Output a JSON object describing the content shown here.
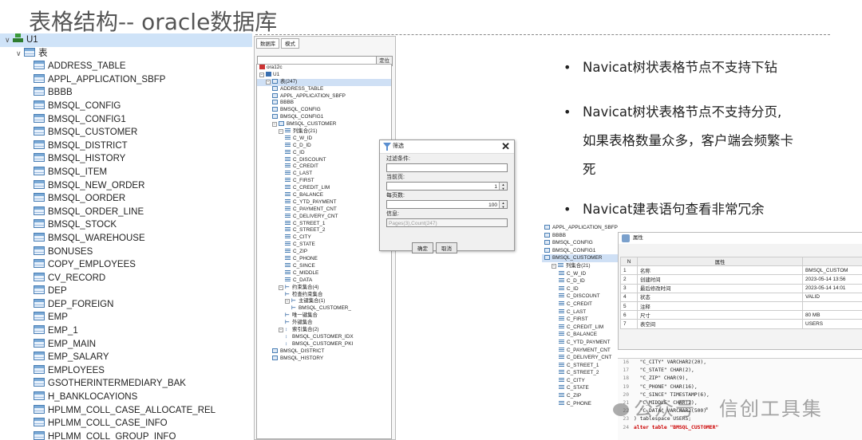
{
  "slide": {
    "title": "表格结构-- oracle数据库"
  },
  "nav_tree": {
    "root": "U1",
    "group": "表",
    "tables": [
      "ADDRESS_TABLE",
      "APPL_APPLICATION_SBFP",
      "BBBB",
      "BMSQL_CONFIG",
      "BMSQL_CONFIG1",
      "BMSQL_CUSTOMER",
      "BMSQL_DISTRICT",
      "BMSQL_HISTORY",
      "BMSQL_ITEM",
      "BMSQL_NEW_ORDER",
      "BMSQL_OORDER",
      "BMSQL_ORDER_LINE",
      "BMSQL_STOCK",
      "BMSQL_WAREHOUSE",
      "BONUSES",
      "COPY_EMPLOYEES",
      "CV_RECORD",
      "DEP",
      "DEP_FOREIGN",
      "EMP",
      "EMP_1",
      "EMP_MAIN",
      "EMP_SALARY",
      "EMPLOYEES",
      "GSOTHERINTERMEDIARY_BAK",
      "H_BANKLOCAYIONS",
      "HPLMM_COLL_CASE_ALLOCATE_REL",
      "HPLMM_COLL_CASE_INFO",
      "HPLMM_COLL_GROUP_INFO"
    ]
  },
  "client_tree": {
    "tabs": [
      "数据库",
      "模式"
    ],
    "locate_button": "定位",
    "rows": [
      {
        "indent": 0,
        "kind": "db",
        "text": "ora12c"
      },
      {
        "indent": 0,
        "kind": "user",
        "text": "U1",
        "pm": "⊟"
      },
      {
        "indent": 1,
        "kind": "table",
        "text": "表(247)",
        "pm": "⊟",
        "selected": true
      },
      {
        "indent": 2,
        "kind": "table",
        "text": "ADDRESS_TABLE"
      },
      {
        "indent": 2,
        "kind": "table",
        "text": "APPL_APPLICATION_SBFP"
      },
      {
        "indent": 2,
        "kind": "table",
        "text": "BBBB"
      },
      {
        "indent": 2,
        "kind": "table",
        "text": "BMSQL_CONFIG"
      },
      {
        "indent": 2,
        "kind": "table",
        "text": "BMSQL_CONFIG1"
      },
      {
        "indent": 2,
        "kind": "table",
        "text": "BMSQL_CUSTOMER",
        "pm": "⊟"
      },
      {
        "indent": 3,
        "kind": "col",
        "text": "列集合(21)",
        "pm": "⊟"
      },
      {
        "indent": 4,
        "kind": "col",
        "text": "C_W_ID"
      },
      {
        "indent": 4,
        "kind": "col",
        "text": "C_D_ID"
      },
      {
        "indent": 4,
        "kind": "col",
        "text": "C_ID"
      },
      {
        "indent": 4,
        "kind": "col",
        "text": "C_DISCOUNT"
      },
      {
        "indent": 4,
        "kind": "col",
        "text": "C_CREDIT"
      },
      {
        "indent": 4,
        "kind": "col",
        "text": "C_LAST"
      },
      {
        "indent": 4,
        "kind": "col",
        "text": "C_FIRST"
      },
      {
        "indent": 4,
        "kind": "col",
        "text": "C_CREDIT_LIM"
      },
      {
        "indent": 4,
        "kind": "col",
        "text": "C_BALANCE"
      },
      {
        "indent": 4,
        "kind": "col",
        "text": "C_YTD_PAYMENT"
      },
      {
        "indent": 4,
        "kind": "col",
        "text": "C_PAYMENT_CNT"
      },
      {
        "indent": 4,
        "kind": "col",
        "text": "C_DELIVERY_CNT"
      },
      {
        "indent": 4,
        "kind": "col",
        "text": "C_STREET_1"
      },
      {
        "indent": 4,
        "kind": "col",
        "text": "C_STREET_2"
      },
      {
        "indent": 4,
        "kind": "col",
        "text": "C_CITY"
      },
      {
        "indent": 4,
        "kind": "col",
        "text": "C_STATE"
      },
      {
        "indent": 4,
        "kind": "col",
        "text": "C_ZIP"
      },
      {
        "indent": 4,
        "kind": "col",
        "text": "C_PHONE"
      },
      {
        "indent": 4,
        "kind": "col",
        "text": "C_SINCE"
      },
      {
        "indent": 4,
        "kind": "col",
        "text": "C_MIDDLE"
      },
      {
        "indent": 4,
        "kind": "col",
        "text": "C_DATA"
      },
      {
        "indent": 3,
        "kind": "key",
        "text": "约束集合(4)",
        "pm": "⊟"
      },
      {
        "indent": 4,
        "kind": "key",
        "text": "检查约束集合"
      },
      {
        "indent": 4,
        "kind": "key",
        "text": "主键集合(1)",
        "pm": "⊟"
      },
      {
        "indent": 5,
        "kind": "key",
        "text": "BMSQL_CUSTOMER_"
      },
      {
        "indent": 4,
        "kind": "key",
        "text": "唯一键集合"
      },
      {
        "indent": 4,
        "kind": "key",
        "text": "外键集合"
      },
      {
        "indent": 3,
        "kind": "idx",
        "text": "索引集合(2)",
        "pm": "⊟"
      },
      {
        "indent": 4,
        "kind": "idx",
        "text": "BMSQL_CUSTOMER_IDX"
      },
      {
        "indent": 4,
        "kind": "idx",
        "text": "BMSQL_CUSTOMER_PKI"
      },
      {
        "indent": 2,
        "kind": "table",
        "text": "BMSQL_DISTRICT"
      },
      {
        "indent": 2,
        "kind": "table",
        "text": "BMSQL_HISTORY"
      }
    ]
  },
  "filter_dialog": {
    "title": "筛选",
    "close": "✕",
    "condition_label": "过滤条件:",
    "condition_value": "",
    "current_page_label": "当前页:",
    "current_page_value": "1",
    "per_page_label": "每页数:",
    "per_page_value": "100",
    "info_label": "信息:",
    "info_value": "Pages(3),Count(247)",
    "ok_button": "确定",
    "cancel_button": "取消"
  },
  "bullets": {
    "item1": "Navicat树状表格节点不支持下钻",
    "item2_line1": "Navicat树状表格节点不支持分页,",
    "item2_line2": "如果表格数量众多，客户端会频繁卡",
    "item2_line3": "死",
    "item3": "Navicat建表语句查看非常冗余"
  },
  "shot2": {
    "tree_rows": [
      {
        "indent": 0,
        "kind": "table",
        "text": "APPL_APPLICATION_SBFP"
      },
      {
        "indent": 0,
        "kind": "table",
        "text": "BBBB"
      },
      {
        "indent": 0,
        "kind": "table",
        "text": "BMSQL_CONFIG"
      },
      {
        "indent": 0,
        "kind": "table",
        "text": "BMSQL_CONFIG1"
      },
      {
        "indent": 0,
        "kind": "table",
        "text": "BMSQL_CUSTOMER",
        "selected": true
      },
      {
        "indent": 1,
        "kind": "col",
        "text": "列集合(21)",
        "pm": "⊟"
      },
      {
        "indent": 2,
        "kind": "col",
        "text": "C_W_ID"
      },
      {
        "indent": 2,
        "kind": "col",
        "text": "C_D_ID"
      },
      {
        "indent": 2,
        "kind": "col",
        "text": "C_ID"
      },
      {
        "indent": 2,
        "kind": "col",
        "text": "C_DISCOUNT"
      },
      {
        "indent": 2,
        "kind": "col",
        "text": "C_CREDIT"
      },
      {
        "indent": 2,
        "kind": "col",
        "text": "C_LAST"
      },
      {
        "indent": 2,
        "kind": "col",
        "text": "C_FIRST"
      },
      {
        "indent": 2,
        "kind": "col",
        "text": "C_CREDIT_LIM"
      },
      {
        "indent": 2,
        "kind": "col",
        "text": "C_BALANCE"
      },
      {
        "indent": 2,
        "kind": "col",
        "text": "C_YTD_PAYMENT"
      },
      {
        "indent": 2,
        "kind": "col",
        "text": "C_PAYMENT_CNT"
      },
      {
        "indent": 2,
        "kind": "col",
        "text": "C_DELIVERY_CNT"
      },
      {
        "indent": 2,
        "kind": "col",
        "text": "C_STREET_1"
      },
      {
        "indent": 2,
        "kind": "col",
        "text": "C_STREET_2"
      },
      {
        "indent": 2,
        "kind": "col",
        "text": "C_CITY"
      },
      {
        "indent": 2,
        "kind": "col",
        "text": "C_STATE"
      },
      {
        "indent": 2,
        "kind": "col",
        "text": "C_ZIP"
      },
      {
        "indent": 2,
        "kind": "col",
        "text": "C_PHONE"
      }
    ],
    "prop_title": "属性",
    "prop_headers": [
      "N",
      "属性",
      ""
    ],
    "prop_rows": [
      [
        "1",
        "名称",
        "BMSQL_CUSTOM"
      ],
      [
        "2",
        "创建时间",
        "2023-05-14 13:56"
      ],
      [
        "3",
        "最后修改时间",
        "2023-05-14 14:01"
      ],
      [
        "4",
        "状态",
        "VALID"
      ],
      [
        "5",
        "注释",
        ""
      ],
      [
        "6",
        "尺寸",
        "80 MB"
      ],
      [
        "7",
        "表空间",
        "USERS"
      ]
    ],
    "code_lines": [
      {
        "n": "16",
        "t": "  \"C_CITY\" VARCHAR2(20),"
      },
      {
        "n": "17",
        "t": "  \"C_STATE\" CHAR(2),"
      },
      {
        "n": "18",
        "t": "  \"C_ZIP\" CHAR(9),"
      },
      {
        "n": "19",
        "t": "  \"C_PHONE\" CHAR(16),"
      },
      {
        "n": "20",
        "t": "  \"C_SINCE\" TIMESTAMP(6),"
      },
      {
        "n": "21",
        "t": "  \"C_MIDDLE\" CHAR(2),"
      },
      {
        "n": "22",
        "t": "  \"C_DATA\" VARCHAR2(500)"
      },
      {
        "n": "23",
        "t": ") tablespace USERS;"
      },
      {
        "n": "24",
        "t": "alter table \"BMSQL_CUSTOMER\""
      }
    ]
  },
  "watermark": {
    "text": "公众号 · 信创工具集"
  }
}
